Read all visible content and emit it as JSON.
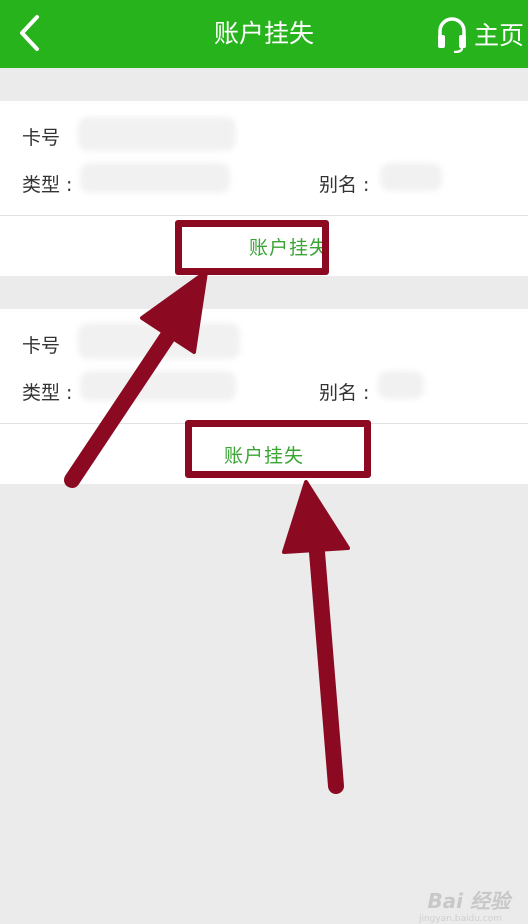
{
  "header": {
    "title": "账户挂失",
    "home_label": "主页"
  },
  "cards": [
    {
      "card_no_label": "卡号",
      "type_label": "类型 :",
      "alias_label": "别名 :",
      "action_label": "账户挂失"
    },
    {
      "card_no_label": "卡号",
      "type_label": "类型 :",
      "alias_label": "别名 :",
      "action_label": "账户挂失"
    }
  ],
  "watermark": {
    "text": "Bai 经验",
    "sub": "jingyan.baidu.com"
  },
  "colors": {
    "header_bg": "#27b31c",
    "action_text": "#3aa535",
    "annotation": "#8b0a22",
    "page_bg": "#ebebeb"
  }
}
